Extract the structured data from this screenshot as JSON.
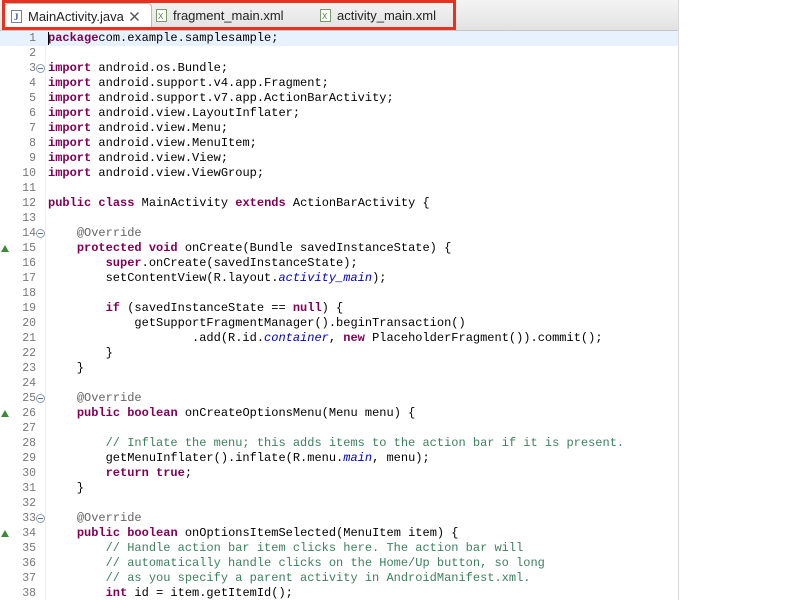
{
  "tabs": [
    {
      "label": "MainActivity.java",
      "icon": "java-file-icon",
      "active": true,
      "close": "close-icon"
    },
    {
      "label": "fragment_main.xml",
      "icon": "xml-file-icon",
      "active": false
    },
    {
      "label": "activity_main.xml",
      "icon": "xml-file-icon",
      "active": false
    }
  ],
  "colors": {
    "keyword": "#7f0055",
    "annotation": "#646464",
    "comment": "#3f7f5f",
    "field": "#0000c0",
    "highlight_box": "#e8321e",
    "current_line": "#e8f2fe"
  },
  "code_lines": [
    {
      "num": "1",
      "segs": [
        [
          "kw",
          "package"
        ],
        [
          "",
          "com.example.samplesample;"
        ]
      ]
    },
    {
      "num": "2",
      "segs": []
    },
    {
      "num": "3",
      "fold": true,
      "segs": [
        [
          "kw",
          "import"
        ],
        [
          "",
          " android.os.Bundle;"
        ]
      ]
    },
    {
      "num": "4",
      "segs": [
        [
          "kw",
          "import"
        ],
        [
          "",
          " android.support.v4.app.Fragment;"
        ]
      ]
    },
    {
      "num": "5",
      "segs": [
        [
          "kw",
          "import"
        ],
        [
          "",
          " android.support.v7.app.ActionBarActivity;"
        ]
      ]
    },
    {
      "num": "6",
      "segs": [
        [
          "kw",
          "import"
        ],
        [
          "",
          " android.view.LayoutInflater;"
        ]
      ]
    },
    {
      "num": "7",
      "segs": [
        [
          "kw",
          "import"
        ],
        [
          "",
          " android.view.Menu;"
        ]
      ]
    },
    {
      "num": "8",
      "segs": [
        [
          "kw",
          "import"
        ],
        [
          "",
          " android.view.MenuItem;"
        ]
      ]
    },
    {
      "num": "9",
      "segs": [
        [
          "kw",
          "import"
        ],
        [
          "",
          " android.view.View;"
        ]
      ]
    },
    {
      "num": "10",
      "segs": [
        [
          "kw",
          "import"
        ],
        [
          "",
          " android.view.ViewGroup;"
        ]
      ]
    },
    {
      "num": "11",
      "segs": []
    },
    {
      "num": "12",
      "segs": [
        [
          "kw",
          "public"
        ],
        [
          "",
          " "
        ],
        [
          "kw",
          "class"
        ],
        [
          "",
          " MainActivity "
        ],
        [
          "kw",
          "extends"
        ],
        [
          "",
          " ActionBarActivity {"
        ]
      ]
    },
    {
      "num": "13",
      "segs": []
    },
    {
      "num": "14",
      "fold": true,
      "segs": [
        [
          "",
          "    "
        ],
        [
          "ann",
          "@Override"
        ]
      ]
    },
    {
      "num": "15",
      "marker": true,
      "segs": [
        [
          "",
          "    "
        ],
        [
          "kw",
          "protected"
        ],
        [
          "",
          " "
        ],
        [
          "kw",
          "void"
        ],
        [
          "",
          " onCreate(Bundle savedInstanceState) {"
        ]
      ]
    },
    {
      "num": "16",
      "segs": [
        [
          "",
          "        "
        ],
        [
          "kw",
          "super"
        ],
        [
          "",
          ".onCreate(savedInstanceState);"
        ]
      ]
    },
    {
      "num": "17",
      "segs": [
        [
          "",
          "        setContentView(R.layout."
        ],
        [
          "it",
          "activity_main"
        ],
        [
          "",
          ");"
        ]
      ]
    },
    {
      "num": "18",
      "segs": []
    },
    {
      "num": "19",
      "segs": [
        [
          "",
          "        "
        ],
        [
          "kw",
          "if"
        ],
        [
          "",
          " (savedInstanceState == "
        ],
        [
          "kw",
          "null"
        ],
        [
          "",
          ") {"
        ]
      ]
    },
    {
      "num": "20",
      "segs": [
        [
          "",
          "            getSupportFragmentManager().beginTransaction()"
        ]
      ]
    },
    {
      "num": "21",
      "segs": [
        [
          "",
          "                    .add(R.id."
        ],
        [
          "it",
          "container"
        ],
        [
          "",
          ", "
        ],
        [
          "kw",
          "new"
        ],
        [
          "",
          " PlaceholderFragment()).commit();"
        ]
      ]
    },
    {
      "num": "22",
      "segs": [
        [
          "",
          "        }"
        ]
      ]
    },
    {
      "num": "23",
      "segs": [
        [
          "",
          "    }"
        ]
      ]
    },
    {
      "num": "24",
      "segs": []
    },
    {
      "num": "25",
      "fold": true,
      "segs": [
        [
          "",
          "    "
        ],
        [
          "ann",
          "@Override"
        ]
      ]
    },
    {
      "num": "26",
      "marker": true,
      "segs": [
        [
          "",
          "    "
        ],
        [
          "kw",
          "public"
        ],
        [
          "",
          " "
        ],
        [
          "kw",
          "boolean"
        ],
        [
          "",
          " onCreateOptionsMenu(Menu menu) {"
        ]
      ]
    },
    {
      "num": "27",
      "segs": []
    },
    {
      "num": "28",
      "segs": [
        [
          "",
          "        "
        ],
        [
          "cm",
          "// Inflate the menu; this adds items to the action bar if it is present."
        ]
      ]
    },
    {
      "num": "29",
      "segs": [
        [
          "",
          "        getMenuInflater().inflate(R.menu."
        ],
        [
          "it",
          "main"
        ],
        [
          "",
          ", menu);"
        ]
      ]
    },
    {
      "num": "30",
      "segs": [
        [
          "",
          "        "
        ],
        [
          "kw",
          "return"
        ],
        [
          "",
          " "
        ],
        [
          "kw",
          "true"
        ],
        [
          "",
          ";"
        ]
      ]
    },
    {
      "num": "31",
      "segs": [
        [
          "",
          "    }"
        ]
      ]
    },
    {
      "num": "32",
      "segs": []
    },
    {
      "num": "33",
      "fold": true,
      "segs": [
        [
          "",
          "    "
        ],
        [
          "ann",
          "@Override"
        ]
      ]
    },
    {
      "num": "34",
      "marker": true,
      "segs": [
        [
          "",
          "    "
        ],
        [
          "kw",
          "public"
        ],
        [
          "",
          " "
        ],
        [
          "kw",
          "boolean"
        ],
        [
          "",
          " onOptionsItemSelected(MenuItem item) {"
        ]
      ]
    },
    {
      "num": "35",
      "segs": [
        [
          "",
          "        "
        ],
        [
          "cm",
          "// Handle action bar item clicks here. The action bar will"
        ]
      ]
    },
    {
      "num": "36",
      "segs": [
        [
          "",
          "        "
        ],
        [
          "cm",
          "// automatically handle clicks on the Home/Up button, so long"
        ]
      ]
    },
    {
      "num": "37",
      "segs": [
        [
          "",
          "        "
        ],
        [
          "cm",
          "// as you specify a parent activity in AndroidManifest.xml."
        ]
      ]
    },
    {
      "num": "38",
      "segs": [
        [
          "",
          "        "
        ],
        [
          "kw",
          "int"
        ],
        [
          "",
          " id = item.getItemId();"
        ]
      ]
    }
  ]
}
